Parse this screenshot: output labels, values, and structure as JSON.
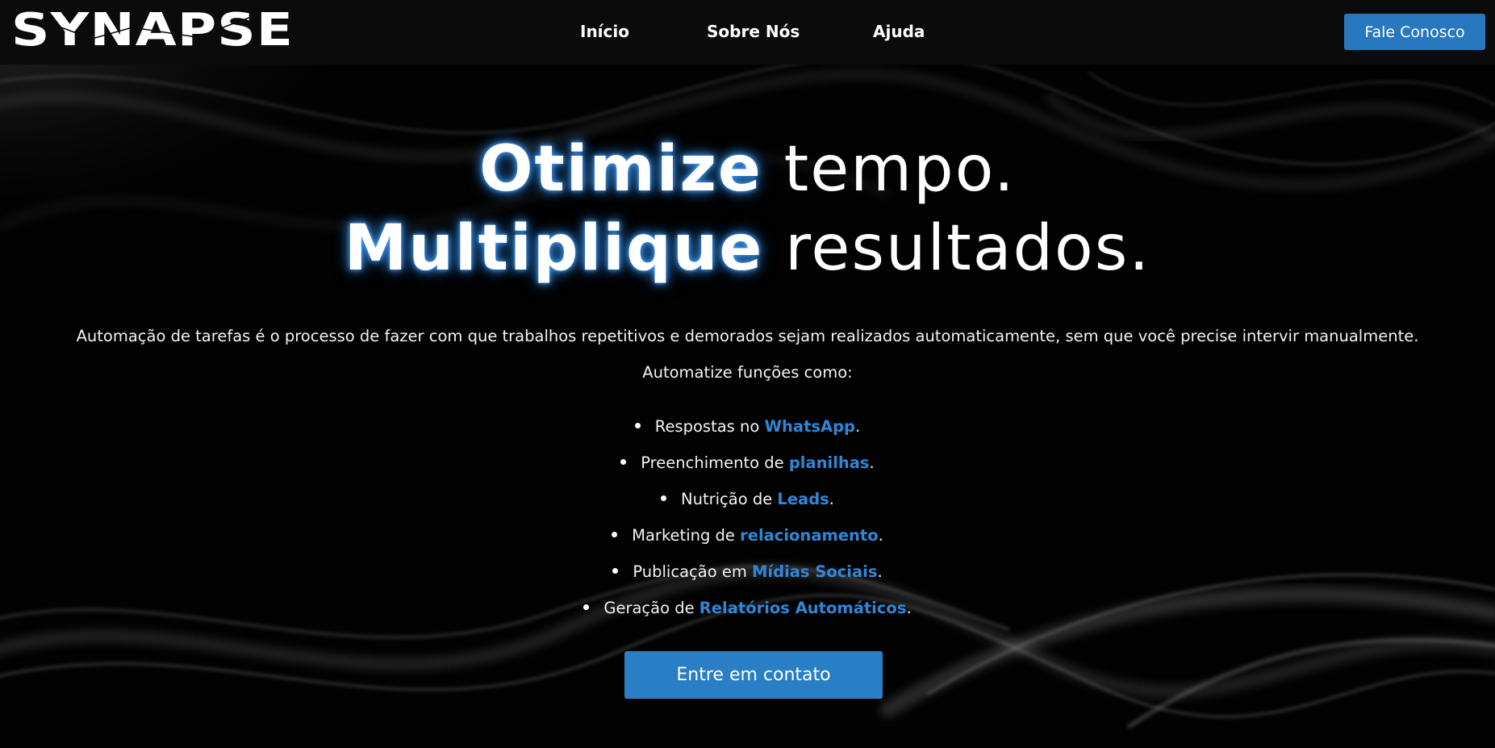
{
  "brand": {
    "logo_text": "SYNAPSE"
  },
  "nav": {
    "items": [
      {
        "label": "Início"
      },
      {
        "label": "Sobre Nós"
      },
      {
        "label": "Ajuda"
      }
    ],
    "cta_label": "Fale Conosco"
  },
  "hero": {
    "line1_highlight": "Otimize",
    "line1_rest": " tempo.",
    "line2_highlight": "Multiplique",
    "line2_rest": " resultados.",
    "intro": "Automação de tarefas é o processo de fazer com que trabalhos repetitivos e demorados sejam realizados automaticamente, sem que você precise intervir manualmente.",
    "subheading": "Automatize funções como:",
    "features": [
      {
        "prefix": "Respostas no ",
        "highlight": "WhatsApp",
        "suffix": "."
      },
      {
        "prefix": "Preenchimento de ",
        "highlight": "planilhas",
        "suffix": "."
      },
      {
        "prefix": "Nutrição de ",
        "highlight": "Leads",
        "suffix": "."
      },
      {
        "prefix": "Marketing de ",
        "highlight": "relacionamento",
        "suffix": "."
      },
      {
        "prefix": "Publicação em ",
        "highlight": "Mídias Sociais",
        "suffix": "."
      },
      {
        "prefix": "Geração de ",
        "highlight": "Relatórios Automáticos",
        "suffix": "."
      }
    ],
    "cta_label": "Entre em contato"
  },
  "colors": {
    "accent": "#2878bf",
    "highlight_text": "#3186d8",
    "background": "#020202",
    "topbar": "#0b0b0b"
  }
}
